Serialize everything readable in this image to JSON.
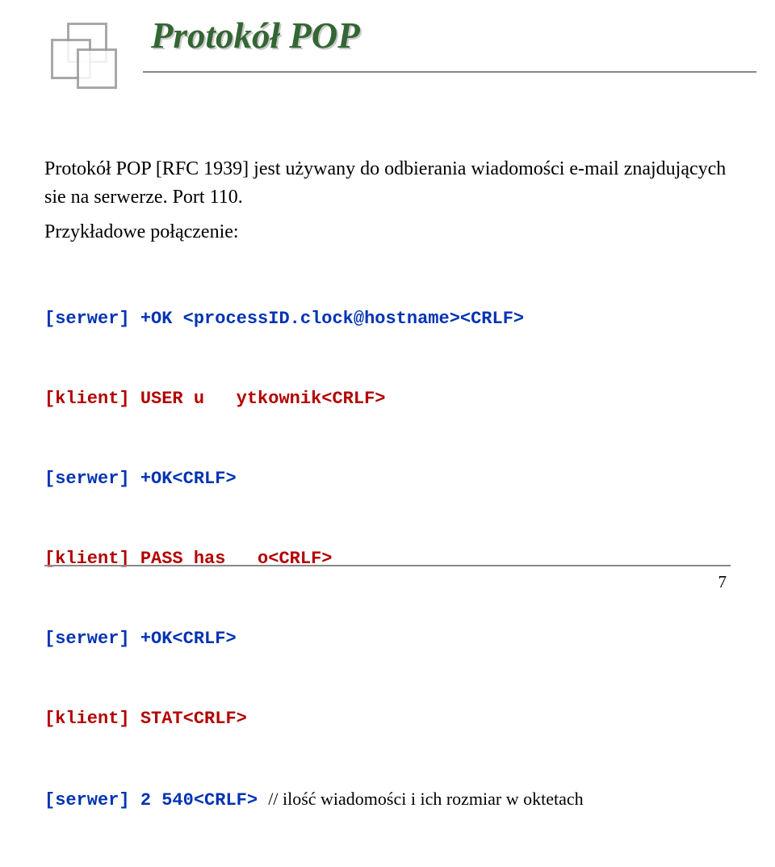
{
  "title": "Protokół POP",
  "intro": "Protokół POP [RFC 1939] jest używany do odbierania wiadomości e-mail znajdujących sie na serwerze. Port 110.",
  "example_label": "Przykładowe połączenie:",
  "code": {
    "line1_prefix": "[serwer] ",
    "line1_rest": "+OK <processID.clock@hostname><CRLF>",
    "line2_prefix": "[klient] ",
    "line2_rest": "USER u   ytkownik<CRLF>",
    "line3_prefix": "[serwer] ",
    "line3_rest": "+OK<CRLF>",
    "line4_prefix": "[klient] ",
    "line4_rest": "PASS has   o<CRLF>",
    "line5_prefix": "[serwer] ",
    "line5_rest": "+OK<CRLF>",
    "line6_prefix": "[klient] ",
    "line6_rest": "STAT<CRLF>",
    "line7_prefix": "[serwer] ",
    "line7_mid": "2 540<CRLF> ",
    "line7_comment": "// ilość wiadomości i ich rozmiar w oktetach"
  },
  "page_number": "7"
}
